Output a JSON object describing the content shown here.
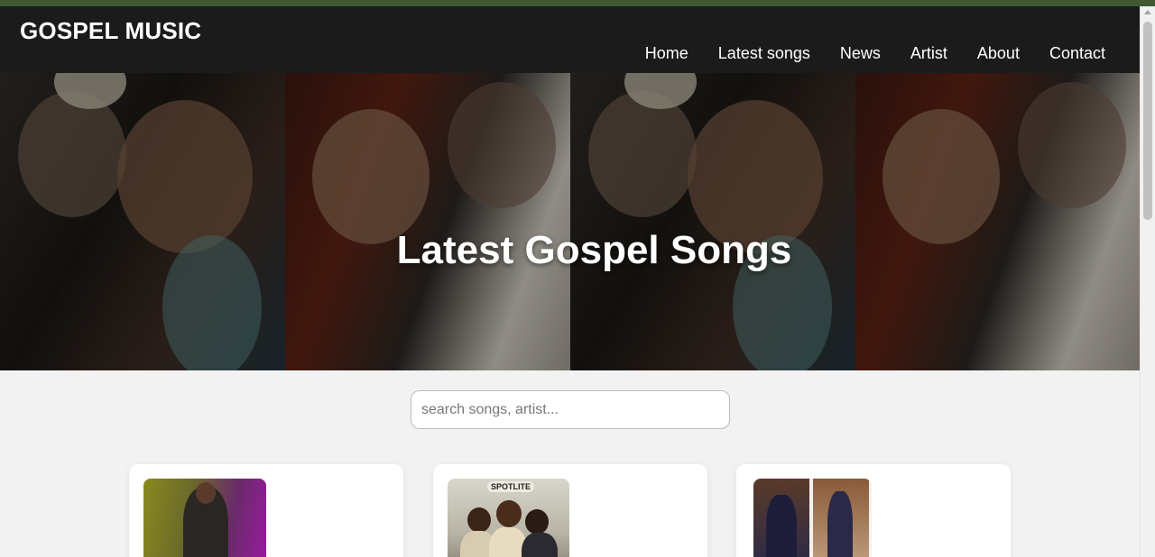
{
  "header": {
    "brand": "GOSPEL MUSIC",
    "nav": [
      "Home",
      "Latest songs",
      "News",
      "Artist",
      "About",
      "Contact"
    ]
  },
  "hero": {
    "title": "Latest Gospel Songs"
  },
  "search": {
    "placeholder": "search songs, artist..."
  },
  "cards": [
    {
      "thumb": "artist-photo"
    },
    {
      "thumb": "album-cover",
      "cover_text": "SPOTLITE"
    },
    {
      "thumb": "artist-photo"
    }
  ],
  "colors": {
    "top_strip": "#3d5a32",
    "header_bg": "#1b1b1b",
    "page_bg": "#f2f2f2"
  }
}
